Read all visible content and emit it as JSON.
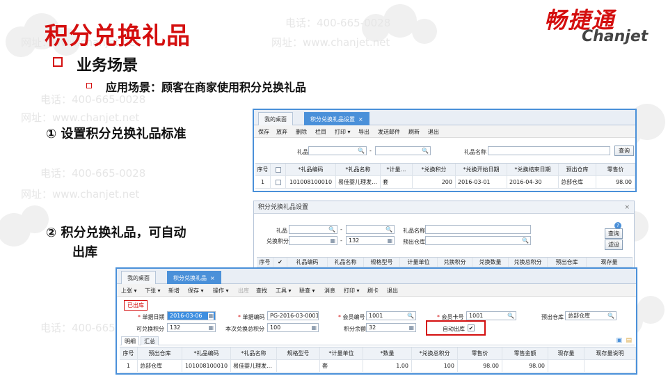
{
  "watermark": {
    "phone": "电话：400-665-0028",
    "website": "网址：www.chanjet.net"
  },
  "slide": {
    "title": "积分兑换礼品",
    "logo_cn": "畅捷通",
    "logo_en": "Chanjet",
    "section": "业务场景",
    "scenario": "应用场景：顾客在商家使用积分兑换礼品",
    "step1": "① 设置积分兑换礼品标准",
    "step2_line1": "② 积分兑换礼品，可自动",
    "step2_line2": "出库"
  },
  "colors": {
    "brand_red": "#d40f0f",
    "accent_blue": "#4a90d9"
  },
  "win1": {
    "tabs": [
      "我的桌面",
      "积分兑换礼品设置"
    ],
    "toolbar": [
      "保存",
      "放弃",
      "删除",
      "栏目",
      "打印 ▾",
      "导出",
      "发送邮件",
      "刷新",
      "退出"
    ],
    "filter": {
      "gift_label": "礼品",
      "range_sep": "-",
      "gift_name_label": "礼品名称",
      "query_btn": "查询"
    },
    "columns": [
      "序号",
      "",
      "*礼品编码",
      "*礼品名称",
      "*计量…",
      "*兑换积分",
      "*兑换开始日期",
      "*兑换结束日期",
      "预出仓库",
      "零售价"
    ],
    "rows": [
      [
        "1",
        "",
        "101008100010",
        "易佳婴儿理发…",
        "套",
        "200",
        "2016-03-01",
        "2016-04-30",
        "总部仓库",
        "98.00"
      ]
    ]
  },
  "win2": {
    "title": "积分兑换礼品设置",
    "gift_label": "礼品",
    "range_sep": "-",
    "gift_name_label": "礼品名称",
    "points_label": "兑换积分",
    "points_value": "132",
    "warehouse_label": "预出仓库",
    "query_btn": "查询",
    "filter_btn": "滤设",
    "help_icon": "?",
    "columns": [
      "序号",
      "✔",
      "礼品编码",
      "礼品名称",
      "规格型号",
      "计量单位",
      "兑换积分",
      "兑换数量",
      "兑换总积分",
      "预出仓库",
      "现存量"
    ]
  },
  "win3": {
    "tabs": [
      "我的桌面",
      "积分兑换礼品"
    ],
    "toolbar": [
      "上张 ▾",
      "下张 ▾",
      "新增",
      "保存 ▾",
      "操作 ▾",
      "出库",
      "查找",
      "工具 ▾",
      "联查 ▾",
      "消息",
      "打印 ▾",
      "刷卡",
      "退出"
    ],
    "status_badge": "已出库",
    "form": {
      "doc_date_label": "单据日期",
      "doc_date": "2016-03-06",
      "doc_no_label": "单据编码",
      "doc_no": "PG-2016-03-0001",
      "member_no_label": "会员编号",
      "member_no": "1001",
      "card_no_label": "会员卡号",
      "card_no": "1001",
      "warehouse_label": "预出仓库",
      "warehouse": "总部仓库",
      "available_points_label": "可兑换积分",
      "available_points": "132",
      "this_total_label": "本次兑换总积分",
      "this_total": "100",
      "balance_label": "积分余额",
      "balance": "32",
      "auto_out_label": "自动出库",
      "auto_out_checked": "✔"
    },
    "subtabs": [
      "明细",
      "汇总"
    ],
    "columns": [
      "序号",
      "预出仓库",
      "*礼品编码",
      "*礼品名称",
      "规格型号",
      "*计量单位",
      "*数量",
      "*兑换总积分",
      "零售价",
      "零售金额",
      "现存量",
      "现存量说明"
    ],
    "rows": [
      [
        "1",
        "总部仓库",
        "101008100010",
        "易佳婴儿理发…",
        "",
        "套",
        "1.00",
        "100",
        "98.00",
        "98.00",
        "",
        ""
      ]
    ]
  }
}
